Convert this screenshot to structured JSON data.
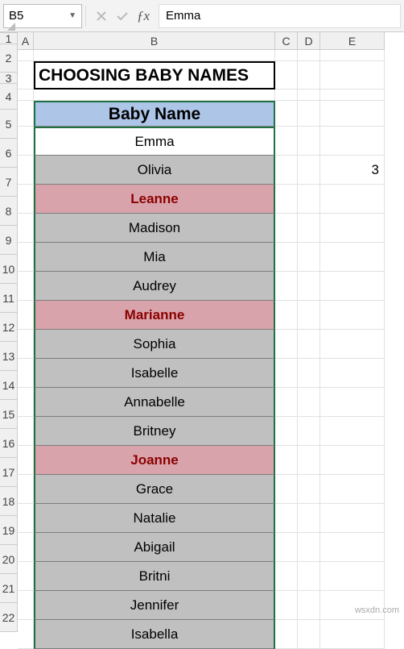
{
  "formula_bar": {
    "cell_ref": "B5",
    "value": "Emma"
  },
  "columns": [
    "A",
    "B",
    "C",
    "D",
    "E"
  ],
  "rows": [
    "1",
    "2",
    "3",
    "4",
    "5",
    "6",
    "7",
    "8",
    "9",
    "10",
    "11",
    "12",
    "13",
    "14",
    "15",
    "16",
    "17",
    "18",
    "19",
    "20",
    "21",
    "22"
  ],
  "title": "CHOOSING BABY NAMES",
  "header": "Baby Name",
  "names": [
    {
      "v": "Emma",
      "sel": true,
      "pink": false
    },
    {
      "v": "Olivia",
      "sel": false,
      "pink": false
    },
    {
      "v": "Leanne",
      "sel": false,
      "pink": true
    },
    {
      "v": "Madison",
      "sel": false,
      "pink": false
    },
    {
      "v": "Mia",
      "sel": false,
      "pink": false
    },
    {
      "v": "Audrey",
      "sel": false,
      "pink": false
    },
    {
      "v": "Marianne",
      "sel": false,
      "pink": true
    },
    {
      "v": "Sophia",
      "sel": false,
      "pink": false
    },
    {
      "v": "Isabelle",
      "sel": false,
      "pink": false
    },
    {
      "v": "Annabelle",
      "sel": false,
      "pink": false
    },
    {
      "v": "Britney",
      "sel": false,
      "pink": false
    },
    {
      "v": "Joanne",
      "sel": false,
      "pink": true
    },
    {
      "v": "Grace",
      "sel": false,
      "pink": false
    },
    {
      "v": "Natalie",
      "sel": false,
      "pink": false
    },
    {
      "v": "Abigail",
      "sel": false,
      "pink": false
    },
    {
      "v": "Britni",
      "sel": false,
      "pink": false
    },
    {
      "v": "Jennifer",
      "sel": false,
      "pink": false
    },
    {
      "v": "Isabella",
      "sel": false,
      "pink": false
    }
  ],
  "count_value": "3",
  "row_heights": {
    "title": 35,
    "header": 32,
    "data": 36,
    "small": 14
  },
  "watermark": "wsxdn.com"
}
